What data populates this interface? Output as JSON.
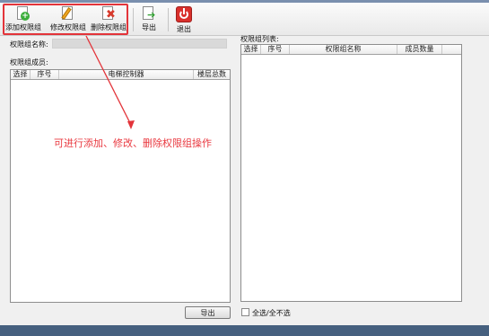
{
  "toolbar": {
    "buttons": [
      {
        "label": "添加权限组",
        "icon": "add-document-icon"
      },
      {
        "label": "修改权限组",
        "icon": "edit-pencil-icon"
      },
      {
        "label": "删除权限组",
        "icon": "delete-x-icon"
      },
      {
        "label": "导出",
        "icon": "export-arrow-icon"
      },
      {
        "label": "退出",
        "icon": "power-exit-icon"
      }
    ]
  },
  "left": {
    "name_label": "权限组名称:",
    "name_value": "",
    "members_label": "权限组成员:",
    "columns": [
      "选择",
      "序号",
      "电梯控制器",
      "楼层总数"
    ],
    "rows": []
  },
  "right": {
    "list_label": "权限组列表:",
    "columns": [
      "选择",
      "序号",
      "权限组名称",
      "成员数量"
    ],
    "rows": []
  },
  "footer": {
    "export_label": "导出",
    "select_all_label": "全选/全不选",
    "select_all_checked": false
  },
  "annotation": {
    "text": "可进行添加、修改、删除权限组操作",
    "color": "#e9383f"
  }
}
